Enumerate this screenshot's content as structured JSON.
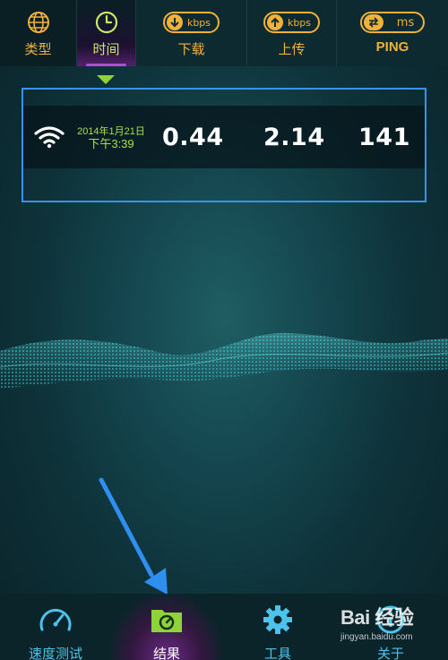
{
  "header": {
    "columns": [
      {
        "label": "类型",
        "icon": "globe-icon"
      },
      {
        "label": "时间",
        "icon": "clock-icon"
      },
      {
        "label": "下载",
        "icon": "download-icon",
        "unit": "kbps"
      },
      {
        "label": "上传",
        "icon": "upload-icon",
        "unit": "kbps"
      },
      {
        "label": "PING",
        "icon": "ping-icon",
        "unit": "ms"
      }
    ],
    "selected": "时间"
  },
  "result": {
    "connection_icon": "wifi-icon",
    "date": "2014年1月21日",
    "time": "下午3:39",
    "download": "0.44",
    "upload": "2.14",
    "ping": "141"
  },
  "nav": {
    "items": [
      {
        "label": "速度测试",
        "icon": "speedometer-icon"
      },
      {
        "label": "结果",
        "icon": "folder-icon"
      },
      {
        "label": "工具",
        "icon": "gear-icon"
      },
      {
        "label": "关于",
        "icon": "info-icon"
      }
    ],
    "active": "结果"
  },
  "watermark": {
    "logo": "Bai 经验",
    "url": "jingyan.baidu.com"
  },
  "colors": {
    "accent_orange": "#f2b13a",
    "accent_green": "#a8e04a",
    "highlight_blue": "#3a93f0",
    "nav_icon": "#4cc3ec"
  }
}
